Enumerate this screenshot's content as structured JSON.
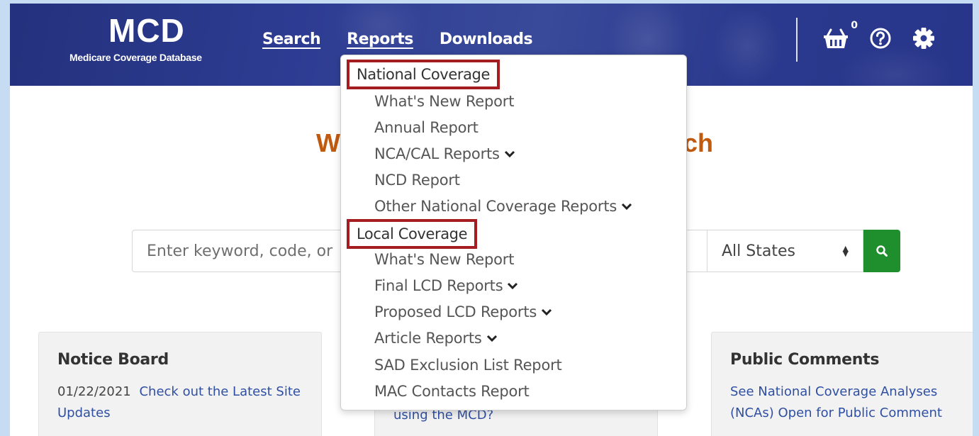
{
  "header": {
    "logo_title": "MCD",
    "logo_subtitle": "Medicare Coverage Database",
    "nav": [
      "Search",
      "Reports",
      "Downloads"
    ],
    "basket_count": "0",
    "icons": [
      "basket-icon",
      "help-icon",
      "gear-icon"
    ]
  },
  "main": {
    "welcome_left": "W",
    "welcome_right": "ch",
    "search_placeholder": "Enter keyword, code, or",
    "state_select": "All States"
  },
  "dropdown": {
    "national_heading": "National Coverage",
    "national_items": [
      "What's New Report",
      "Annual Report",
      "NCA/CAL Reports",
      "NCD Report",
      "Other National Coverage Reports"
    ],
    "local_heading": "Local Coverage",
    "local_items": [
      "What's New Report",
      "Final LCD Reports",
      "Proposed LCD Reports",
      "Article Reports",
      "SAD Exclusion List Report",
      "MAC Contacts Report"
    ]
  },
  "cards": {
    "notice": {
      "title": "Notice Board",
      "date": "01/22/2021",
      "link": "Check out the Latest Site Updates"
    },
    "middle": {
      "link": "using the MCD?"
    },
    "public": {
      "title": "Public Comments",
      "link": "See National Coverage Analyses (NCAs) Open for Public Comment"
    }
  },
  "colors": {
    "header_blue": "#2d3c92",
    "welcome_orange": "#c05a0e",
    "search_green": "#1f8f2e",
    "highlight_red": "#a51d20",
    "link_blue": "#2f4fa2"
  }
}
